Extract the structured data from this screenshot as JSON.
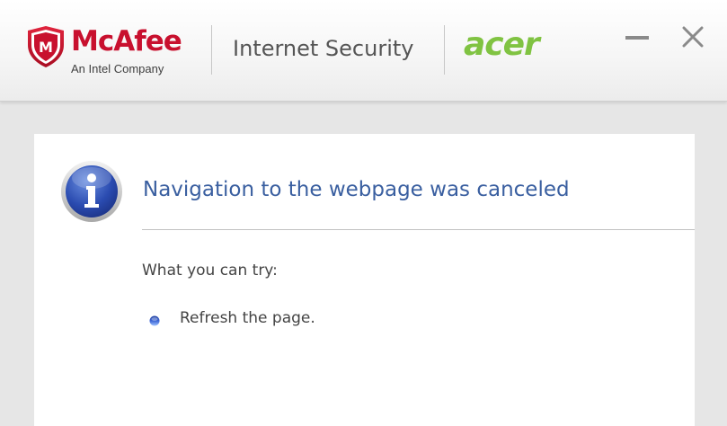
{
  "header": {
    "brand_name": "McAfee",
    "brand_tagline": "An Intel Company",
    "shield_letter": "M",
    "product_name": "Internet Security",
    "oem_logo": "acer",
    "minimize_icon": "minimize-icon",
    "close_icon": "close-icon"
  },
  "message": {
    "icon": "info-icon",
    "title": "Navigation to the webpage was canceled",
    "subhead": "What you can try:",
    "suggestions": [
      {
        "text": "Refresh the page.",
        "icon": "bullet-icon"
      }
    ]
  },
  "colors": {
    "brand_red": "#c8102e",
    "acer_green": "#80c342",
    "title_blue": "#3a5fa0",
    "body_text": "#444444",
    "background": "#e6e6e6"
  }
}
